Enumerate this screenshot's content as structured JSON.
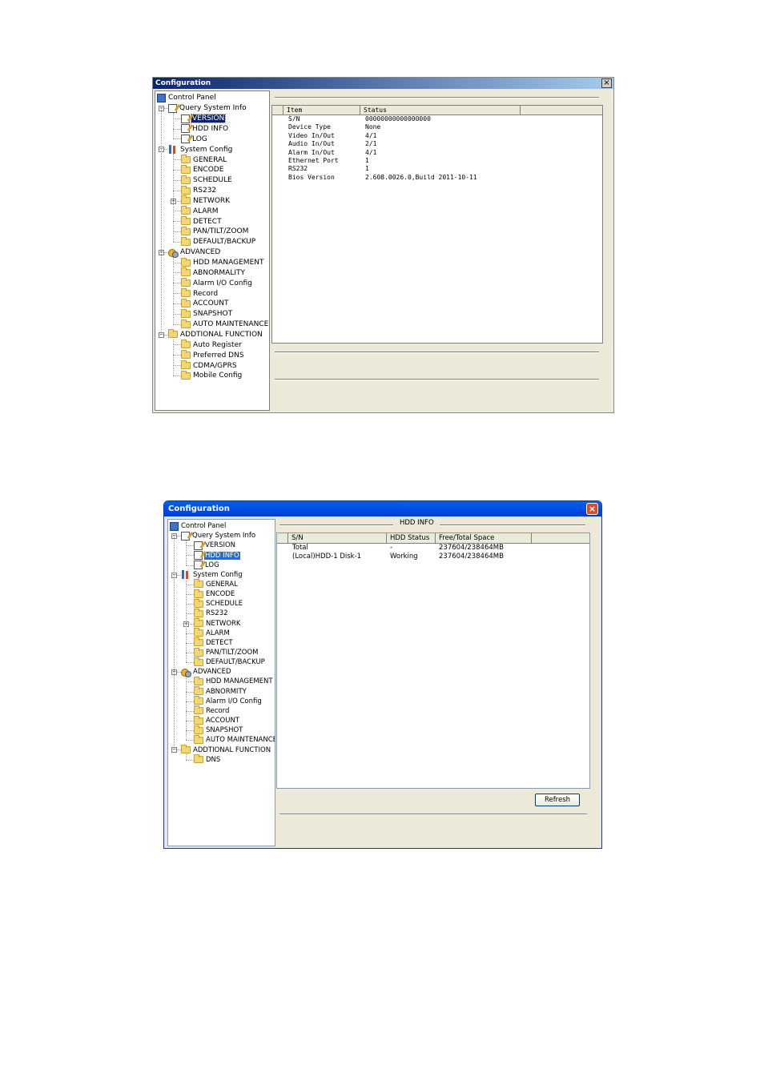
{
  "window1": {
    "title": "Configuration",
    "close_glyph": "×",
    "tree": [
      {
        "label": "Control Panel",
        "icon": "control-panel-icon",
        "level": 0
      },
      {
        "label": "Query System Info",
        "icon": "query-icon",
        "level": 1,
        "expander": "−"
      },
      {
        "label": "VERSION",
        "icon": "note-icon",
        "level": 2,
        "selected": true
      },
      {
        "label": "HDD INFO",
        "icon": "note-icon",
        "level": 2
      },
      {
        "label": "LOG",
        "icon": "note-icon",
        "level": 2
      },
      {
        "label": "System Config",
        "icon": "system-config-icon",
        "level": 1,
        "expander": "−"
      },
      {
        "label": "GENERAL",
        "icon": "folder-icon",
        "level": 2
      },
      {
        "label": "ENCODE",
        "icon": "folder-icon",
        "level": 2
      },
      {
        "label": "SCHEDULE",
        "icon": "folder-icon",
        "level": 2
      },
      {
        "label": "RS232",
        "icon": "folder-icon",
        "level": 2
      },
      {
        "label": "NETWORK",
        "icon": "folder-icon",
        "level": 2,
        "expander": "+"
      },
      {
        "label": "ALARM",
        "icon": "folder-icon",
        "level": 2
      },
      {
        "label": "DETECT",
        "icon": "folder-icon",
        "level": 2
      },
      {
        "label": "PAN/TILT/ZOOM",
        "icon": "folder-icon",
        "level": 2
      },
      {
        "label": "DEFAULT/BACKUP",
        "icon": "folder-icon",
        "level": 2
      },
      {
        "label": "ADVANCED",
        "icon": "advanced-icon",
        "level": 1,
        "expander": "−"
      },
      {
        "label": "HDD MANAGEMENT",
        "icon": "folder-icon",
        "level": 2
      },
      {
        "label": "ABNORMALITY",
        "icon": "folder-icon",
        "level": 2
      },
      {
        "label": "Alarm I/O Config",
        "icon": "folder-icon",
        "level": 2
      },
      {
        "label": "Record",
        "icon": "folder-icon",
        "level": 2
      },
      {
        "label": "ACCOUNT",
        "icon": "folder-icon",
        "level": 2
      },
      {
        "label": "SNAPSHOT",
        "icon": "folder-icon",
        "level": 2
      },
      {
        "label": "AUTO MAINTENANCE",
        "icon": "folder-icon",
        "level": 2
      },
      {
        "label": "ADDTIONAL FUNCTION",
        "icon": "folder-icon",
        "level": 1,
        "expander": "−"
      },
      {
        "label": "Auto Register",
        "icon": "folder-icon",
        "level": 2
      },
      {
        "label": "Preferred DNS",
        "icon": "folder-icon",
        "level": 2
      },
      {
        "label": "CDMA/GPRS",
        "icon": "folder-icon",
        "level": 2
      },
      {
        "label": "Mobile Config",
        "icon": "folder-icon",
        "level": 2
      }
    ],
    "table": {
      "columns": [
        "Item",
        "Status"
      ],
      "rows": [
        [
          "S/N",
          "00000000000000000"
        ],
        [
          "Device Type",
          "None"
        ],
        [
          "Video In/Out",
          "4/1"
        ],
        [
          "Audio In/Out",
          "2/1"
        ],
        [
          "Alarm In/Out",
          "4/1"
        ],
        [
          "Ethernet Port",
          "1"
        ],
        [
          "RS232",
          "1"
        ],
        [
          "Bios Version",
          "2.608.0026.0,Build 2011-10-11"
        ]
      ]
    }
  },
  "window2": {
    "title": "Configuration",
    "close_glyph": "×",
    "panel_title": "HDD INFO",
    "refresh_label": "Refresh",
    "tree": [
      {
        "label": "Control Panel",
        "icon": "control-panel-icon",
        "level": 0
      },
      {
        "label": "Query System Info",
        "icon": "query-icon",
        "level": 1,
        "expander": "−"
      },
      {
        "label": "VERSION",
        "icon": "note-icon",
        "level": 2
      },
      {
        "label": "HDD INFO",
        "icon": "note-icon",
        "level": 2,
        "selected": true
      },
      {
        "label": "LOG",
        "icon": "note-icon",
        "level": 2
      },
      {
        "label": "System Config",
        "icon": "system-config-icon",
        "level": 1,
        "expander": "−"
      },
      {
        "label": "GENERAL",
        "icon": "folder-icon",
        "level": 2
      },
      {
        "label": "ENCODE",
        "icon": "folder-icon",
        "level": 2
      },
      {
        "label": "SCHEDULE",
        "icon": "folder-icon",
        "level": 2
      },
      {
        "label": "RS232",
        "icon": "folder-icon",
        "level": 2
      },
      {
        "label": "NETWORK",
        "icon": "folder-icon",
        "level": 2,
        "expander": "+"
      },
      {
        "label": "ALARM",
        "icon": "folder-icon",
        "level": 2
      },
      {
        "label": "DETECT",
        "icon": "folder-icon",
        "level": 2
      },
      {
        "label": "PAN/TILT/ZOOM",
        "icon": "folder-icon",
        "level": 2
      },
      {
        "label": "DEFAULT/BACKUP",
        "icon": "folder-icon",
        "level": 2
      },
      {
        "label": "ADVANCED",
        "icon": "advanced-icon",
        "level": 1,
        "expander": "−"
      },
      {
        "label": "HDD MANAGEMENT",
        "icon": "folder-icon",
        "level": 2
      },
      {
        "label": "ABNORMITY",
        "icon": "folder-icon",
        "level": 2
      },
      {
        "label": "Alarm I/O Config",
        "icon": "folder-icon",
        "level": 2
      },
      {
        "label": "Record",
        "icon": "folder-icon",
        "level": 2
      },
      {
        "label": "ACCOUNT",
        "icon": "folder-icon",
        "level": 2
      },
      {
        "label": "SNAPSHOT",
        "icon": "folder-icon",
        "level": 2
      },
      {
        "label": "AUTO MAINTENANCE",
        "icon": "folder-icon",
        "level": 2
      },
      {
        "label": "ADDTIONAL FUNCTION",
        "icon": "folder-icon",
        "level": 1,
        "expander": "−"
      },
      {
        "label": "DNS",
        "icon": "folder-icon",
        "level": 2
      }
    ],
    "table": {
      "columns": [
        "S/N",
        "HDD Status",
        "Free/Total Space"
      ],
      "rows": [
        [
          "Total",
          "-",
          "237604/238464MB"
        ],
        [
          "(Local)HDD-1 Disk-1",
          "Working",
          "237604/238464MB"
        ]
      ]
    }
  }
}
